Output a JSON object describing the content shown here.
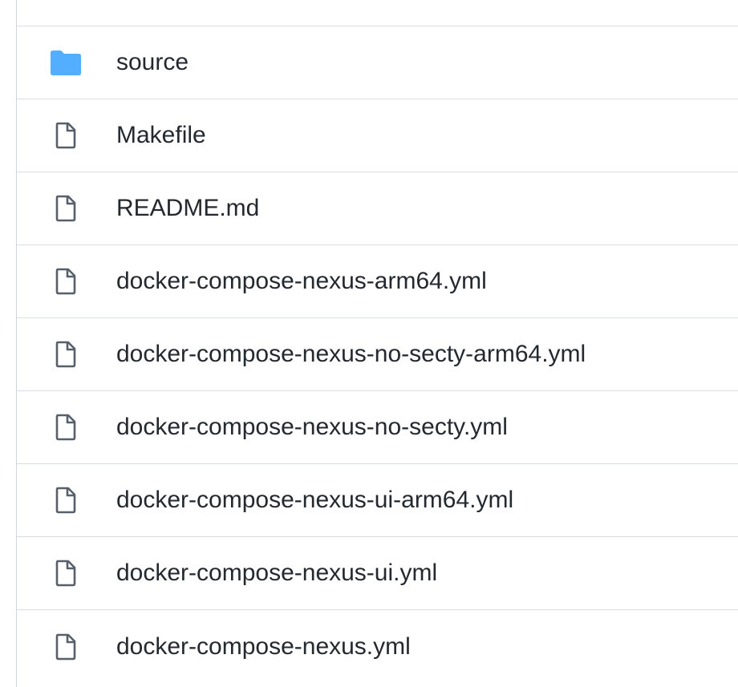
{
  "files": [
    {
      "name": "source",
      "type": "folder",
      "icon": "folder-icon"
    },
    {
      "name": "Makefile",
      "type": "file",
      "icon": "file-icon"
    },
    {
      "name": "README.md",
      "type": "file",
      "icon": "file-icon"
    },
    {
      "name": "docker-compose-nexus-arm64.yml",
      "type": "file",
      "icon": "file-icon"
    },
    {
      "name": "docker-compose-nexus-no-secty-arm64.yml",
      "type": "file",
      "icon": "file-icon"
    },
    {
      "name": "docker-compose-nexus-no-secty.yml",
      "type": "file",
      "icon": "file-icon"
    },
    {
      "name": "docker-compose-nexus-ui-arm64.yml",
      "type": "file",
      "icon": "file-icon"
    },
    {
      "name": "docker-compose-nexus-ui.yml",
      "type": "file",
      "icon": "file-icon"
    },
    {
      "name": "docker-compose-nexus.yml",
      "type": "file",
      "icon": "file-icon"
    }
  ],
  "colors": {
    "folder": "#54aeff",
    "file_icon": "#57606a",
    "text": "#24292f",
    "divider": "#d8dee4"
  }
}
